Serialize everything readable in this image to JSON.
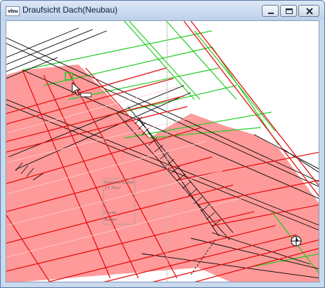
{
  "window": {
    "title": "Draufsicht Dach(Neubau)",
    "app_icon_text": "visu"
  },
  "controls": {
    "minimize_icon": "minimize-icon",
    "maximize_icon": "maximize-icon",
    "close_icon": "close-icon"
  },
  "drawing": {
    "room_label": {
      "name": "Kommunikation",
      "area": "17.75m²",
      "line3": "-",
      "line4": "-",
      "line5": "Decke",
      "line6": "Boden"
    }
  },
  "colors": {
    "roof_fill": "#ff9a9a",
    "rafter_red": "#e81010",
    "batten_green": "#22cc22",
    "line_black": "#000000",
    "window_frame": "#c9d9ee"
  }
}
